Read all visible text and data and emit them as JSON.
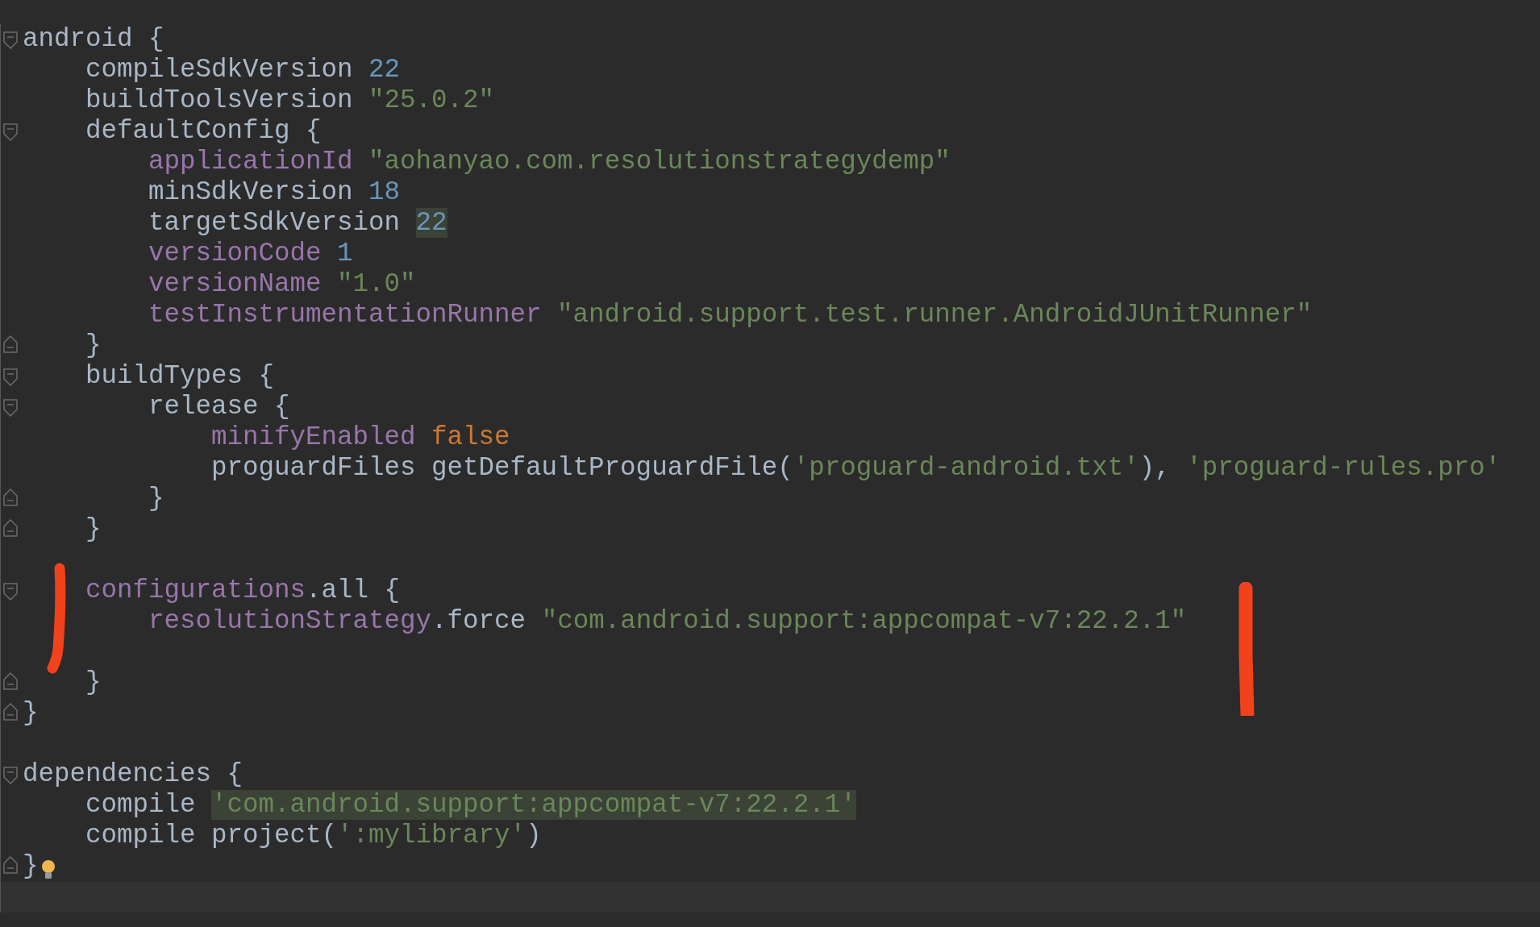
{
  "editor": {
    "lines": [
      {
        "kind": "code",
        "fold_open": true,
        "tokens": [
          {
            "kind": "plain",
            "text": "android {"
          }
        ]
      },
      {
        "kind": "code",
        "tokens": [
          {
            "kind": "plain",
            "text": "    compileSdkVersion "
          },
          {
            "kind": "number",
            "text": "22"
          }
        ]
      },
      {
        "kind": "code",
        "tokens": [
          {
            "kind": "plain",
            "text": "    buildToolsVersion "
          },
          {
            "kind": "string",
            "text": "\"25.0.2\""
          }
        ]
      },
      {
        "kind": "code",
        "fold_open": true,
        "tokens": [
          {
            "kind": "plain",
            "text": "    defaultConfig {"
          }
        ]
      },
      {
        "kind": "code",
        "tokens": [
          {
            "kind": "property",
            "text": "        applicationId "
          },
          {
            "kind": "string",
            "text": "\"aohanyao.com.resolutionstrategydemp\""
          }
        ]
      },
      {
        "kind": "code",
        "tokens": [
          {
            "kind": "plain",
            "text": "        minSdkVersion "
          },
          {
            "kind": "number",
            "text": "18"
          }
        ]
      },
      {
        "kind": "code",
        "tokens": [
          {
            "kind": "plain",
            "text": "        targetSdkVersion "
          },
          {
            "kind": "number",
            "text": "22",
            "highlight": true
          }
        ]
      },
      {
        "kind": "code",
        "tokens": [
          {
            "kind": "property",
            "text": "        versionCode "
          },
          {
            "kind": "number",
            "text": "1"
          }
        ]
      },
      {
        "kind": "code",
        "tokens": [
          {
            "kind": "property",
            "text": "        versionName "
          },
          {
            "kind": "string",
            "text": "\"1.0\""
          }
        ]
      },
      {
        "kind": "code",
        "tokens": [
          {
            "kind": "property",
            "text": "        testInstrumentationRunner "
          },
          {
            "kind": "string",
            "text": "\"android.support.test.runner.AndroidJUnitRunner\""
          }
        ]
      },
      {
        "kind": "code",
        "fold_close": true,
        "tokens": [
          {
            "kind": "plain",
            "text": "    }"
          }
        ]
      },
      {
        "kind": "code",
        "fold_open": true,
        "tokens": [
          {
            "kind": "plain",
            "text": "    buildTypes {"
          }
        ]
      },
      {
        "kind": "code",
        "fold_open": true,
        "tokens": [
          {
            "kind": "plain",
            "text": "        release {"
          }
        ]
      },
      {
        "kind": "code",
        "tokens": [
          {
            "kind": "property",
            "text": "            minifyEnabled "
          },
          {
            "kind": "keyword",
            "text": "false"
          }
        ]
      },
      {
        "kind": "code",
        "tokens": [
          {
            "kind": "plain",
            "text": "            proguardFiles getDefaultProguardFile("
          },
          {
            "kind": "string",
            "text": "'proguard-android.txt'"
          },
          {
            "kind": "plain",
            "text": "), "
          },
          {
            "kind": "string",
            "text": "'proguard-rules.pro'"
          }
        ]
      },
      {
        "kind": "code",
        "fold_close": true,
        "tokens": [
          {
            "kind": "plain",
            "text": "        }"
          }
        ]
      },
      {
        "kind": "code",
        "fold_close": true,
        "tokens": [
          {
            "kind": "plain",
            "text": "    }"
          }
        ]
      },
      {
        "kind": "blank"
      },
      {
        "kind": "code",
        "fold_open": true,
        "tokens": [
          {
            "kind": "property",
            "text": "    configurations"
          },
          {
            "kind": "plain",
            "text": ".all {"
          }
        ]
      },
      {
        "kind": "code",
        "tokens": [
          {
            "kind": "property",
            "text": "        resolutionStrategy"
          },
          {
            "kind": "plain",
            "text": ".force "
          },
          {
            "kind": "string",
            "text": "\"com.android.support:appcompat-v7:22.2.1\""
          }
        ]
      },
      {
        "kind": "blank"
      },
      {
        "kind": "code",
        "fold_close": true,
        "tokens": [
          {
            "kind": "plain",
            "text": "    }"
          }
        ]
      },
      {
        "kind": "code",
        "fold_close": true,
        "tokens": [
          {
            "kind": "plain",
            "text": "}"
          }
        ]
      },
      {
        "kind": "blank"
      },
      {
        "kind": "code",
        "fold_open": true,
        "tokens": [
          {
            "kind": "plain",
            "text": "dependencies {"
          }
        ]
      },
      {
        "kind": "code",
        "tokens": [
          {
            "kind": "plain",
            "text": "    compile "
          },
          {
            "kind": "string",
            "text": "'com.android.support:appcompat-v7:22.2.1'",
            "highlight": true
          }
        ]
      },
      {
        "kind": "code",
        "tokens": [
          {
            "kind": "plain",
            "text": "    compile project("
          },
          {
            "kind": "string",
            "text": "':mylibrary'"
          },
          {
            "kind": "plain",
            "text": ")"
          }
        ]
      },
      {
        "kind": "code",
        "fold_close": true,
        "bulb": true,
        "tokens": [
          {
            "kind": "plain",
            "text": "}"
          }
        ]
      },
      {
        "kind": "blank",
        "current": true
      }
    ]
  }
}
